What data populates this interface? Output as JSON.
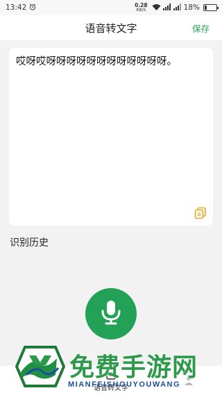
{
  "status_bar": {
    "time": "13:42",
    "speed_value": "0.28",
    "speed_unit": "KB/S",
    "battery": "18%",
    "battery_level": 0.18
  },
  "header": {
    "title": "语音转文字",
    "save_label": "保存"
  },
  "main": {
    "recognized_text": "哎呀哎呀呀呀呀呀呀呀呀呀呀呀呀。",
    "history_label": "识别历史"
  },
  "bottom_nav": {
    "items": [
      {
        "label": "语音转文字"
      }
    ]
  },
  "watermark": {
    "title": "免费手游网",
    "subtitle": "MIANFEISHOUYOUWANG"
  },
  "colors": {
    "accent": "#23a257",
    "save": "#27a65a",
    "copy_icon": "#e0a91e",
    "watermark_green": "#2c9a4a",
    "watermark_blue": "#1b4f9c"
  },
  "icons": [
    "alarm-icon",
    "wifi-icon",
    "signal-icon",
    "battery-icon",
    "copy-icon",
    "microphone-icon"
  ]
}
